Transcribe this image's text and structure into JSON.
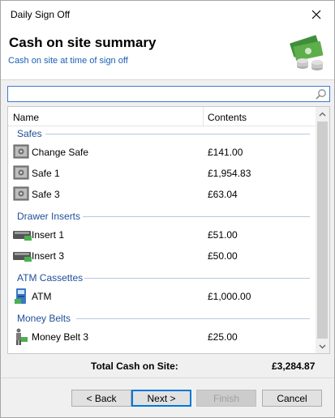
{
  "window": {
    "title": "Daily Sign Off"
  },
  "header": {
    "title": "Cash on site summary",
    "subtitle": "Cash on site at time of sign off"
  },
  "search": {
    "value": "",
    "placeholder": ""
  },
  "columns": {
    "name": "Name",
    "contents": "Contents"
  },
  "groups": [
    {
      "label": "Safes",
      "items": [
        {
          "name": "Change Safe",
          "contents": "£141.00",
          "icon": "safe-icon"
        },
        {
          "name": "Safe 1",
          "contents": "£1,954.83",
          "icon": "safe-icon"
        },
        {
          "name": "Safe 3",
          "contents": "£63.04",
          "icon": "safe-icon"
        }
      ]
    },
    {
      "label": "Drawer Inserts",
      "items": [
        {
          "name": "Insert 1",
          "contents": "£51.00",
          "icon": "cash-drawer-icon"
        },
        {
          "name": "Insert 3",
          "contents": "£50.00",
          "icon": "cash-drawer-icon"
        }
      ]
    },
    {
      "label": "ATM Cassettes",
      "items": [
        {
          "name": "ATM",
          "contents": "£1,000.00",
          "icon": "atm-icon"
        }
      ]
    },
    {
      "label": "Money Belts",
      "items": [
        {
          "name": "Money Belt 3",
          "contents": "£25.00",
          "icon": "money-belt-icon"
        }
      ]
    }
  ],
  "total": {
    "label": "Total Cash on Site:",
    "value": "£3,284.87"
  },
  "buttons": {
    "back": "< Back",
    "next": "Next >",
    "finish": "Finish",
    "cancel": "Cancel"
  },
  "colors": {
    "accent": "#0078d7",
    "group_text": "#1f4f99",
    "subtitle": "#1a5fb4"
  }
}
